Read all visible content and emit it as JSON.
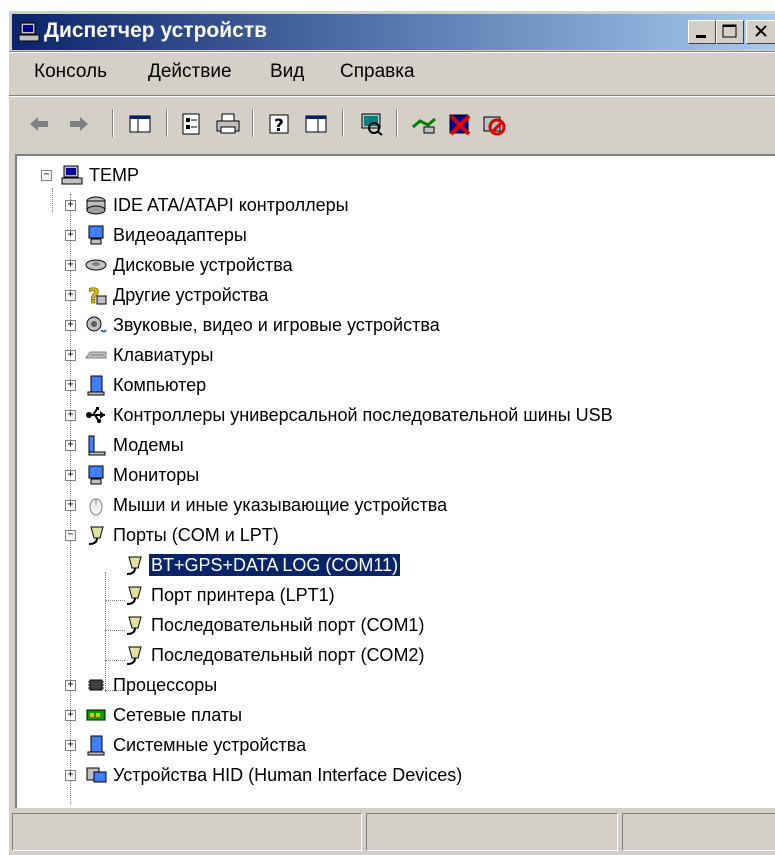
{
  "window": {
    "title": "Диспетчер устройств"
  },
  "menu": [
    {
      "label": "Консоль"
    },
    {
      "label": "Действие"
    },
    {
      "label": "Вид"
    },
    {
      "label": "Справка"
    }
  ],
  "tree": {
    "root": "TEMP",
    "categories": [
      {
        "label": "IDE ATA/ATAPI контроллеры",
        "icon": "ide-controller-icon"
      },
      {
        "label": "Видеоадаптеры",
        "icon": "display-adapter-icon"
      },
      {
        "label": "Дисковые устройства",
        "icon": "disk-drive-icon"
      },
      {
        "label": "Другие устройства",
        "icon": "unknown-device-icon"
      },
      {
        "label": "Звуковые, видео и игровые устройства",
        "icon": "sound-icon"
      },
      {
        "label": "Клавиатуры",
        "icon": "keyboard-icon"
      },
      {
        "label": "Компьютер",
        "icon": "computer-icon"
      },
      {
        "label": "Контроллеры универсальной последовательной шины USB",
        "icon": "usb-icon"
      },
      {
        "label": "Модемы",
        "icon": "modem-icon"
      },
      {
        "label": "Мониторы",
        "icon": "monitor-icon"
      },
      {
        "label": "Мыши и иные указывающие устройства",
        "icon": "mouse-icon"
      },
      {
        "label": "Порты (COM и LPT)",
        "icon": "port-icon"
      }
    ],
    "ports": [
      {
        "label": "BT+GPS+DATA LOG (COM11)",
        "selected": true
      },
      {
        "label": "Порт принтера (LPT1)"
      },
      {
        "label": "Последовательный порт (COM1)"
      },
      {
        "label": "Последовательный порт (COM2)"
      }
    ],
    "after": [
      {
        "label": "Процессоры",
        "icon": "processor-icon"
      },
      {
        "label": "Сетевые платы",
        "icon": "network-adapter-icon"
      },
      {
        "label": "Системные устройства",
        "icon": "system-device-icon"
      },
      {
        "label": "Устройства HID (Human Interface Devices)",
        "icon": "hid-icon"
      }
    ]
  },
  "colors": {
    "selection": "#0a246a",
    "titlebar_start": "#0a246a",
    "titlebar_end": "#a6caf0",
    "face": "#d4d0c8"
  }
}
